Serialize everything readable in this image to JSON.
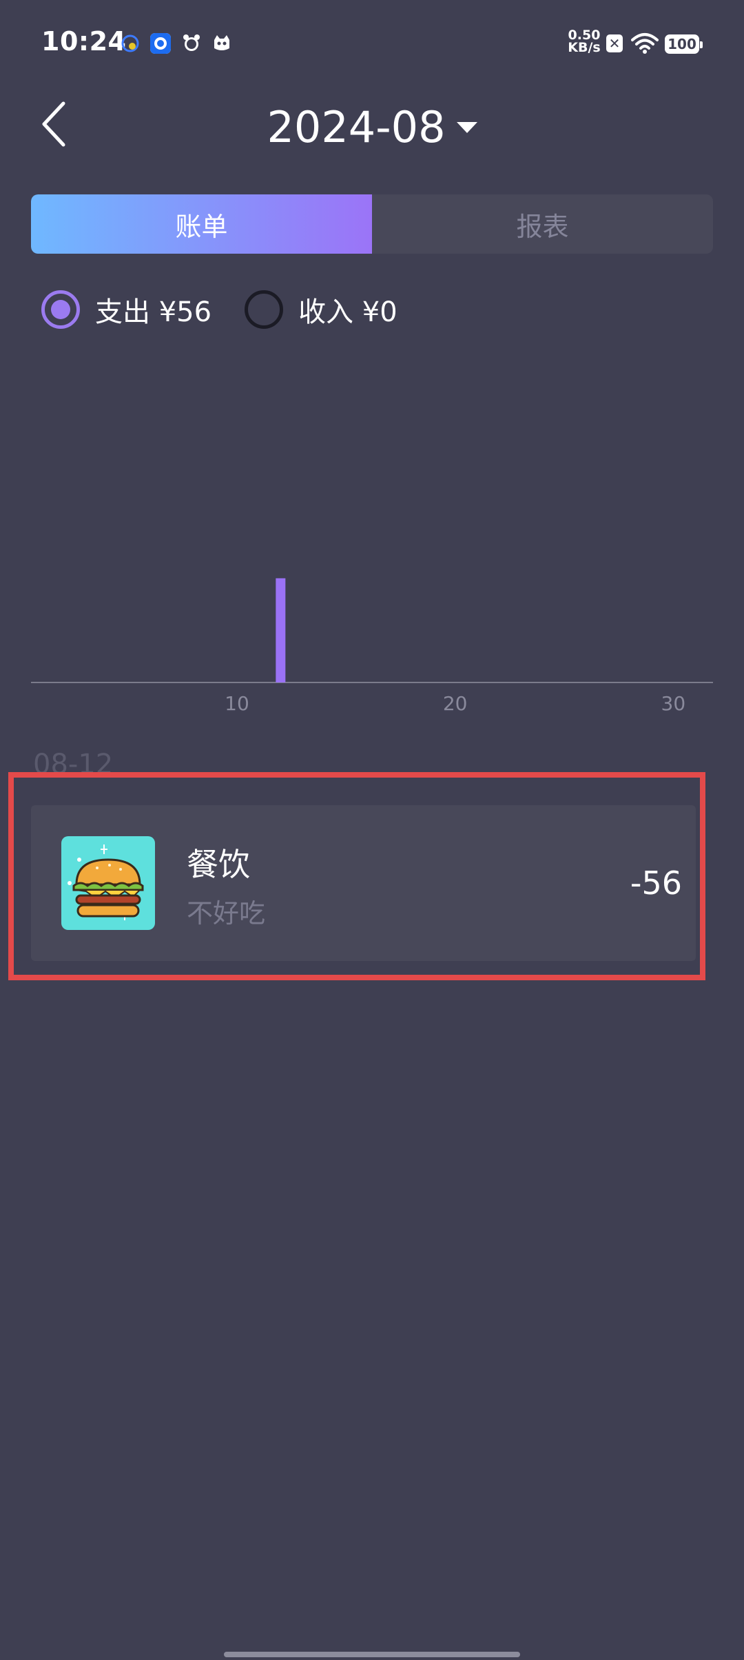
{
  "status_bar": {
    "time": "10:24",
    "net_speed_value": "0.50",
    "net_speed_unit": "KB/s",
    "battery": "100",
    "icons": [
      "vpn-key-icon",
      "app-circle-icon",
      "alarm-icon",
      "cat-face-icon",
      "close-box-icon",
      "wifi-icon",
      "battery-icon"
    ]
  },
  "header": {
    "back_icon": "chevron-left-icon",
    "title": "2024-08",
    "dropdown_icon": "caret-down-icon"
  },
  "tabs": [
    {
      "label": "账单",
      "active": true
    },
    {
      "label": "报表",
      "active": false
    }
  ],
  "filters": {
    "expense": {
      "label": "支出 ¥56",
      "selected": true
    },
    "income": {
      "label": "收入 ¥0",
      "selected": false
    }
  },
  "chart_data": {
    "type": "bar",
    "x": [
      12
    ],
    "values": [
      56
    ],
    "xlim": [
      1,
      31
    ],
    "xticks": [
      "10",
      "20",
      "30"
    ],
    "xtick_values": [
      10,
      20,
      30
    ],
    "ylim": [
      0,
      100
    ],
    "grid": false,
    "bar_color": "#9a72f5"
  },
  "records": {
    "date": "08-12",
    "items": [
      {
        "category": "餐饮",
        "note": "不好吃",
        "amount": "-56",
        "icon": "burger-icon"
      }
    ]
  },
  "colors": {
    "background": "#3f3f52",
    "accent": "#9b7bf0",
    "highlight": "#e44a4a",
    "icon_bg": "#5ee0dd"
  }
}
